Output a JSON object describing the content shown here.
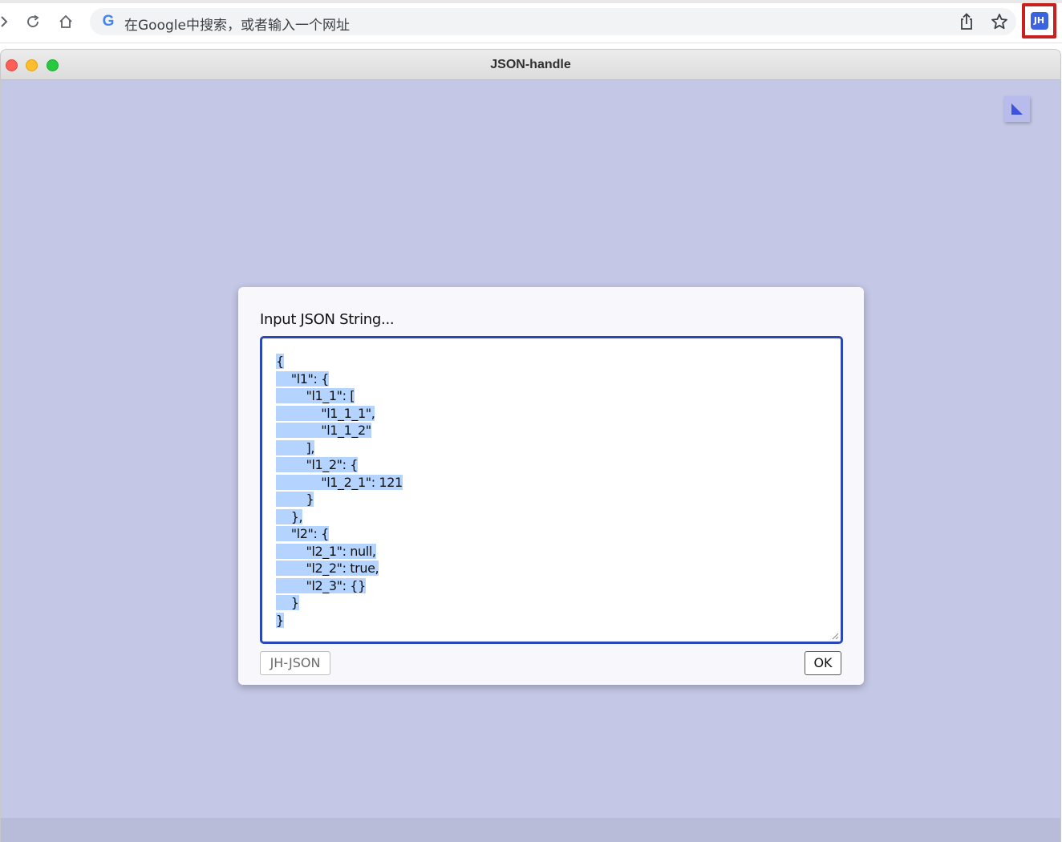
{
  "browser": {
    "omnibox_placeholder": "在Google中搜索，或者输入一个网址",
    "google_logo": "G",
    "extension_badge": "JH",
    "icons": [
      "forward-icon",
      "reload-icon",
      "home-icon",
      "share-icon",
      "star-icon"
    ]
  },
  "window": {
    "title": "JSON-handle"
  },
  "dialog": {
    "label": "Input JSON String...",
    "json_lines": [
      "{",
      "    \"l1\": {",
      "        \"l1_1\": [",
      "            \"l1_1_1\",",
      "            \"l1_1_2\"",
      "        ],",
      "        \"l1_2\": {",
      "            \"l1_2_1\": 121",
      "        }",
      "    },",
      "    \"l2\": {",
      "        \"l2_1\": null,",
      "        \"l2_2\": true,",
      "        \"l2_3\": {}",
      "    }",
      "}"
    ],
    "secondary_button": "JH-JSON",
    "ok_button": "OK"
  },
  "colors": {
    "background": "#c4c8e6",
    "selection": "#b4d4ff",
    "editor_border": "#2a46b8",
    "highlight_box": "#c6201f"
  }
}
